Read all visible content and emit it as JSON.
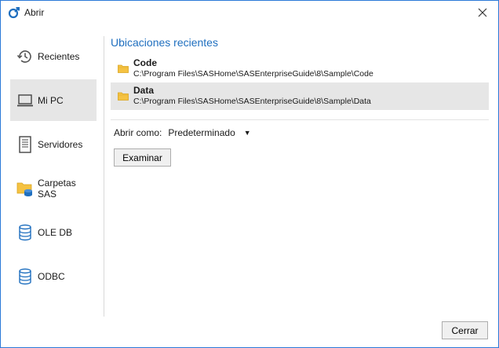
{
  "window": {
    "title": "Abrir",
    "app_icon": "sas-eg-icon",
    "close_icon": "close-icon"
  },
  "sidebar": {
    "items": [
      {
        "label": "Recientes",
        "icon": "history-icon",
        "active": false
      },
      {
        "label": "Mi PC",
        "icon": "laptop-icon",
        "active": true
      },
      {
        "label": "Servidores",
        "icon": "server-icon",
        "active": false
      },
      {
        "label": "Carpetas SAS",
        "icon": "sas-folder-icon",
        "active": false
      },
      {
        "label": "OLE DB",
        "icon": "database-icon",
        "active": false
      },
      {
        "label": "ODBC",
        "icon": "database-icon",
        "active": false
      }
    ]
  },
  "main": {
    "section_title": "Ubicaciones recientes",
    "recent": [
      {
        "name": "Code",
        "path": "C:\\Program Files\\SASHome\\SASEnterpriseGuide\\8\\Sample\\Code",
        "icon": "folder-icon"
      },
      {
        "name": "Data",
        "path": "C:\\Program Files\\SASHome\\SASEnterpriseGuide\\8\\Sample\\Data",
        "icon": "folder-icon"
      }
    ],
    "open_as_label": "Abrir como:",
    "open_as_value": "Predeterminado",
    "browse_label": "Examinar"
  },
  "footer": {
    "close_label": "Cerrar"
  },
  "colors": {
    "accent": "#1f6fbf",
    "border": "#2b79d8",
    "folder": "#f5c242",
    "selection": "#e6e6e6"
  }
}
